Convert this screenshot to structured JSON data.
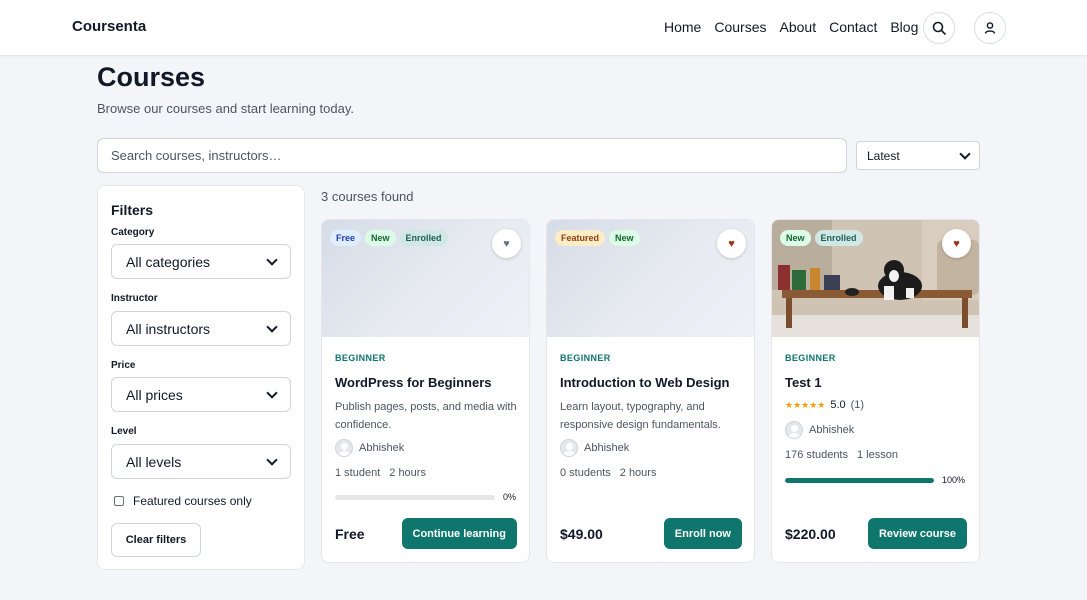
{
  "header": {
    "brand": "Coursenta",
    "nav": [
      "Home",
      "Courses",
      "About",
      "Contact",
      "Blog"
    ]
  },
  "page": {
    "title": "Courses",
    "subtitle": "Browse our courses and start learning today."
  },
  "search": {
    "placeholder": "Search courses, instructors…",
    "value": ""
  },
  "sort": {
    "selected": "Latest"
  },
  "filters": {
    "title": "Filters",
    "category": {
      "label": "Category",
      "selected": "All categories"
    },
    "instructor": {
      "label": "Instructor",
      "selected": "All instructors"
    },
    "price": {
      "label": "Price",
      "selected": "All prices"
    },
    "level": {
      "label": "Level",
      "selected": "All levels"
    },
    "featured_only": {
      "label": "Featured courses only",
      "checked": false
    },
    "clear_label": "Clear filters"
  },
  "results": {
    "count_text": "3 courses found"
  },
  "courses": [
    {
      "badges": [
        "Free",
        "New",
        "Enrolled"
      ],
      "favorite_color": "#6b7280",
      "level": "BEGINNER",
      "title": "WordPress for Beginners",
      "description": "Publish pages, posts, and media with confidence.",
      "instructor": "Abhishek",
      "students": "1 student",
      "duration": "2 hours",
      "progress": 0,
      "progress_label": "0%",
      "price": "Free",
      "action": "Continue learning"
    },
    {
      "badges": [
        "Featured",
        "New"
      ],
      "favorite_color": "#9a3412",
      "level": "BEGINNER",
      "title": "Introduction to Web Design",
      "description": "Learn layout, typography, and responsive design fundamentals.",
      "instructor": "Abhishek",
      "students": "0 students",
      "duration": "2 hours",
      "price": "$49.00",
      "action": "Enroll now"
    },
    {
      "badges": [
        "New",
        "Enrolled"
      ],
      "favorite_color": "#9a3412",
      "level": "BEGINNER",
      "title": "Test 1",
      "rating": "5.0",
      "rating_stars": "★★★★★",
      "rating_count": "(1)",
      "instructor": "Abhishek",
      "students": "176 students",
      "lessons": "1 lesson",
      "progress": 100,
      "progress_label": "100%",
      "price": "$220.00",
      "action": "Review course"
    }
  ],
  "colors": {
    "accent": "#0f766e",
    "heart": "#9a3412"
  },
  "icons": {
    "search": "search-icon",
    "user": "user-icon",
    "favorite": "heart-icon"
  }
}
